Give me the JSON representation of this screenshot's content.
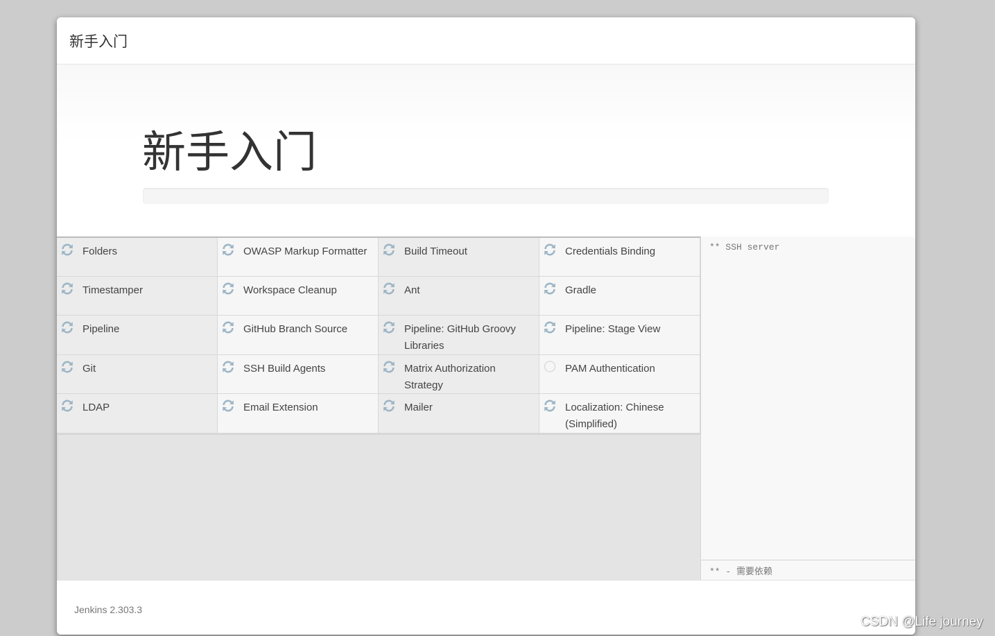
{
  "modal": {
    "header_title": "新手入门",
    "hero_title": "新手入门",
    "progress_percent": 0
  },
  "plugins": [
    {
      "name": "Folders",
      "status": "installing"
    },
    {
      "name": "OWASP Markup Formatter",
      "status": "installing"
    },
    {
      "name": "Build Timeout",
      "status": "installing"
    },
    {
      "name": "Credentials Binding",
      "status": "installing"
    },
    {
      "name": "Timestamper",
      "status": "installing"
    },
    {
      "name": "Workspace Cleanup",
      "status": "installing"
    },
    {
      "name": "Ant",
      "status": "installing"
    },
    {
      "name": "Gradle",
      "status": "installing"
    },
    {
      "name": "Pipeline",
      "status": "installing"
    },
    {
      "name": "GitHub Branch Source",
      "status": "installing"
    },
    {
      "name": "Pipeline: GitHub Groovy Libraries",
      "status": "installing"
    },
    {
      "name": "Pipeline: Stage View",
      "status": "installing"
    },
    {
      "name": "Git",
      "status": "installing"
    },
    {
      "name": "SSH Build Agents",
      "status": "installing"
    },
    {
      "name": "Matrix Authorization Strategy",
      "status": "installing"
    },
    {
      "name": "PAM Authentication",
      "status": "pending"
    },
    {
      "name": "LDAP",
      "status": "installing"
    },
    {
      "name": "Email Extension",
      "status": "installing"
    },
    {
      "name": "Mailer",
      "status": "installing"
    },
    {
      "name": "Localization: Chinese (Simplified)",
      "status": "installing"
    }
  ],
  "icons": {
    "installing": "refresh-icon",
    "pending": "circle-icon"
  },
  "colors": {
    "icon_installing": "#9db5c6",
    "icon_pending": "#dddddd",
    "progress_fill": "#5a9fd4"
  },
  "log": {
    "text": "** SSH server",
    "footer": "** - 需要依赖"
  },
  "footer": {
    "version": "Jenkins 2.303.3"
  },
  "watermark": "CSDN @Life  journey"
}
